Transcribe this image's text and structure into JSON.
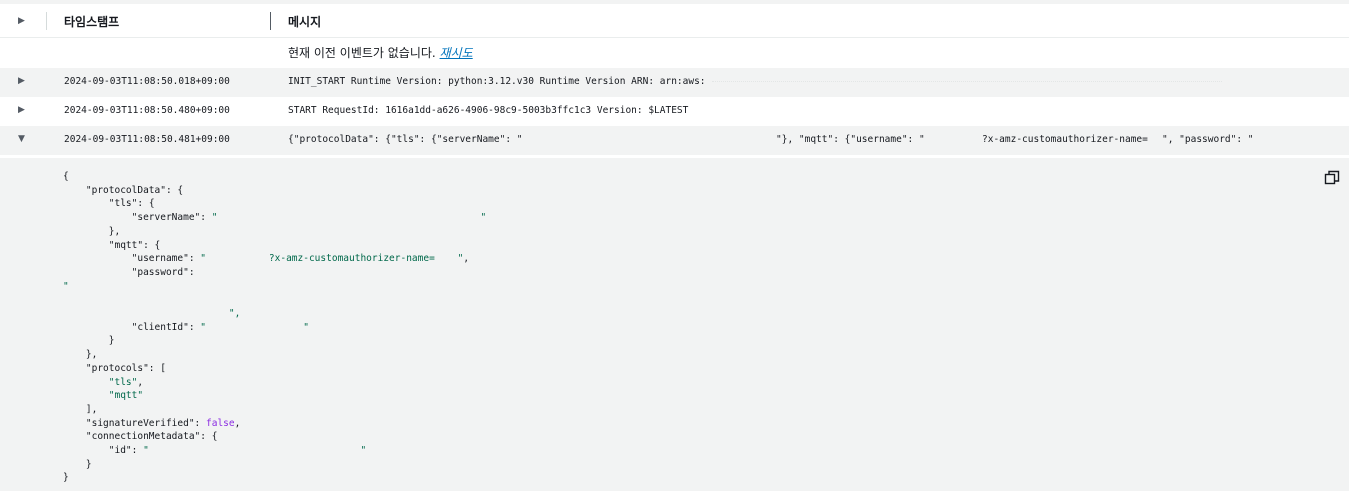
{
  "header": {
    "timestamp_label": "타임스탬프",
    "message_label": "메시지"
  },
  "no_previous": {
    "text": "현재 이전 이벤트가 없습니다.",
    "retry": "재시도"
  },
  "events": [
    {
      "timestamp": "2024-09-03T11:08:50.018+09:00",
      "message": "INIT_START Runtime Version: python:3.12.v30 Runtime Version ARN: arn:aws:",
      "expanded": false
    },
    {
      "timestamp": "2024-09-03T11:08:50.480+09:00",
      "message": "START RequestId: 1616a1dd-a626-4906-98c9-5003b3ffc1c3 Version: $LATEST",
      "expanded": false
    },
    {
      "timestamp": "2024-09-03T11:08:50.481+09:00",
      "message_parts": [
        "{\"protocolData\": {\"tls\": {\"serverName\": \"",
        "\"}, \"mqtt\": {\"username\": \"",
        "?x-amz-customauthorizer-name=",
        "\", \"password\": \""
      ],
      "expanded": true
    }
  ],
  "detail_lines": [
    {
      "t": "{"
    },
    {
      "t": "    \"protocolData\": {"
    },
    {
      "t": "        \"tls\": {"
    },
    {
      "t": "            \"serverName\": \"                                              \""
    },
    {
      "t": "        },"
    },
    {
      "t": "        \"mqtt\": {"
    },
    {
      "t": "            \"username\": \"           ?x-amz-customauthorizer-name=    \","
    },
    {
      "t": "            \"password\":"
    },
    {
      "t": "\""
    },
    {
      "t": ""
    },
    {
      "t": "                             \","
    },
    {
      "t": "            \"clientId\": \"                 \""
    },
    {
      "t": "        }"
    },
    {
      "t": "    },"
    },
    {
      "t": "    \"protocols\": ["
    },
    {
      "t": "        \"tls\","
    },
    {
      "t": "        \"mqtt\""
    },
    {
      "t": "    ],"
    },
    {
      "t": "    \"signatureVerified\": false,"
    },
    {
      "t": "    \"connectionMetadata\": {"
    },
    {
      "t": "        \"id\": \"                                     \""
    },
    {
      "t": "    }"
    },
    {
      "t": "}"
    }
  ],
  "icons": {
    "collapsed": "triangle-right-icon",
    "expanded": "triangle-down-icon",
    "copy": "copy-icon"
  },
  "colors": {
    "row_gray": "#f2f3f3",
    "link": "#0073bb",
    "string": "#00684a",
    "boolean": "#8a2be2"
  }
}
